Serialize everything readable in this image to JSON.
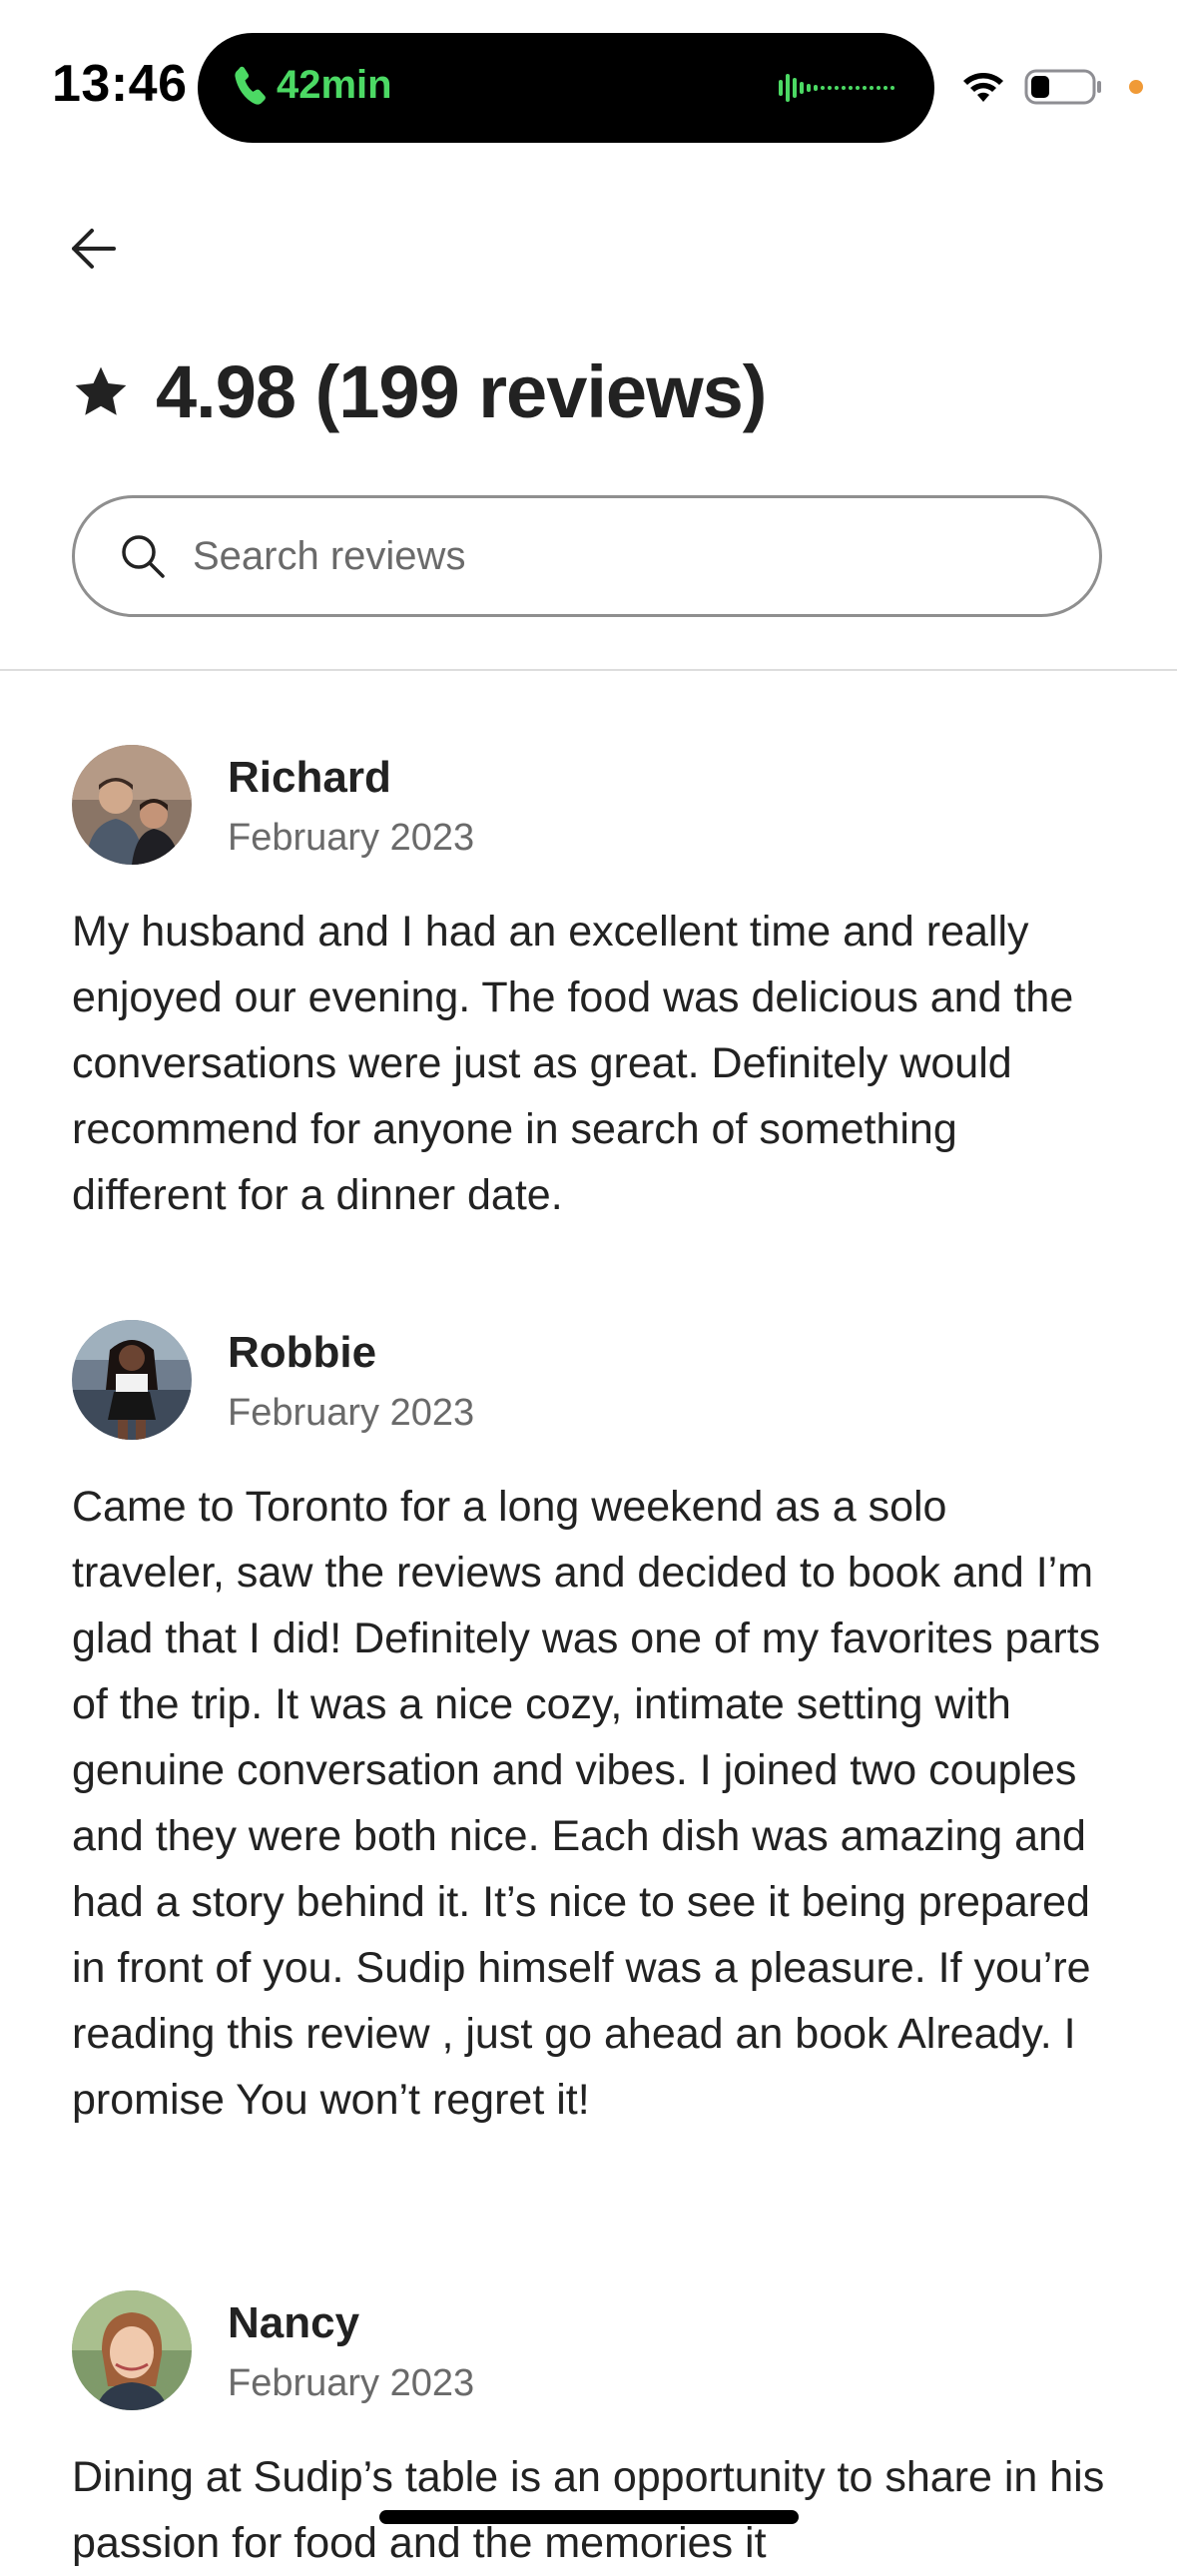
{
  "status_bar": {
    "time": "13:46",
    "call_duration": "42min"
  },
  "header": {
    "back_icon": "arrow-left-icon",
    "rating_summary": "4.98 (199 reviews)"
  },
  "search": {
    "placeholder": "Search reviews"
  },
  "reviews": [
    {
      "name": "Richard",
      "date": "February 2023",
      "text": "My husband and I had an excellent time and really enjoyed our evening. The food was delicious and the conversations were just as great. Definitely would recommend for anyone in search of something different for a dinner date."
    },
    {
      "name": "Robbie",
      "date": "February 2023",
      "text": "Came to Toronto for a long weekend as a solo traveler, saw the reviews and decided to book and I’m glad that I did! Definitely was one of my favorites parts of the trip. It was a nice cozy, intimate setting with genuine conversation and vibes. I joined two couples and they were both nice. Each dish was amazing and had a story behind it. It’s nice to see it being prepared in front of you. Sudip himself was a pleasure. If you’re reading this review , just go ahead an book Already. I promise You won’t regret it!"
    },
    {
      "name": "Nancy",
      "date": "February 2023",
      "text": "Dining at Sudip’s table is an opportunity to share in his passion for food and the memories it"
    }
  ],
  "colors": {
    "text_primary": "#222222",
    "text_secondary": "#6a6a6a",
    "call_green": "#4cd964",
    "divider": "#dddddd"
  }
}
